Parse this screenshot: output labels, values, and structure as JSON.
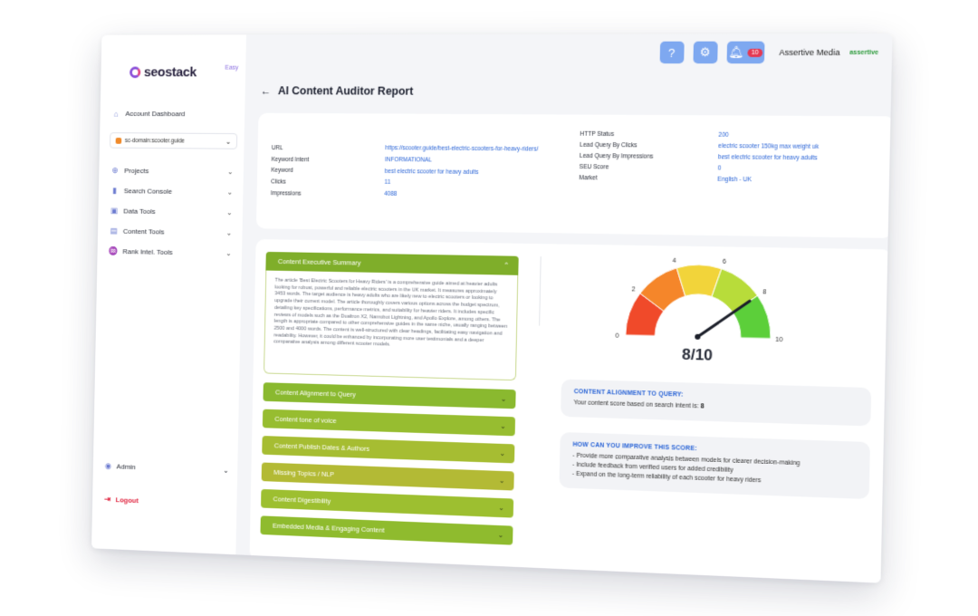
{
  "topbar": {
    "help_icon": "question-circle-icon",
    "settings_icon": "gear-icon",
    "notifications_count": "10",
    "company_name": "Assertive Media",
    "company_logo_text": "assertive"
  },
  "sidebar": {
    "logo_text": "seostack",
    "logo_side": "Easy",
    "account_dashboard": "Account Dashboard",
    "domain": "sc-domain:scooter.guide",
    "items": [
      {
        "label": "Projects",
        "icon": "globe-icon"
      },
      {
        "label": "Search Console",
        "icon": "bar-chart-icon"
      },
      {
        "label": "Data Tools",
        "icon": "data-icon"
      },
      {
        "label": "Content Tools",
        "icon": "content-icon"
      },
      {
        "label": "Rank Intel. Tools",
        "icon": "sitemap-icon"
      }
    ],
    "admin": "Admin",
    "logout": "Logout"
  },
  "page": {
    "title": "AI Content Auditor Report"
  },
  "info": {
    "left": [
      {
        "label": "URL",
        "value": "https://scooter.guide/best-electric-scooters-for-heavy-riders/"
      },
      {
        "label": "Keyword Intent",
        "value": "INFORMATIONAL"
      },
      {
        "label": "Keyword",
        "value": "best electric scooter for heavy adults"
      },
      {
        "label": "Clicks",
        "value": "11"
      },
      {
        "label": "Impressions",
        "value": "4088"
      }
    ],
    "right": [
      {
        "label": "HTTP Status",
        "value": "200"
      },
      {
        "label": "Lead Query By Clicks",
        "value": "electric scooter 150kg max weight uk"
      },
      {
        "label": "Lead Query By Impressions",
        "value": "best electric scooter for heavy adults"
      },
      {
        "label": "SEU Score",
        "value": "0"
      },
      {
        "label": "Market",
        "value": "English - UK"
      }
    ]
  },
  "accordion": {
    "open_title": "Content Executive Summary",
    "open_body": "The article 'Best Electric Scooters for Heavy Riders' is a comprehensive guide aimed at heavier adults looking for robust, powerful and reliable electric scooters in the UK market. It measures approximately 3453 words. The target audience is heavy adults who are likely new to electric scooters or looking to upgrade their current model. The article thoroughly covers various options across the budget spectrum, detailing key specifications, performance metrics, and suitability for heavier riders. It includes specific reviews of models such as the Dualtron X2, Nanrobot Lightning, and Apollo Explore, among others. The length is appropriate compared to other comprehensive guides in the same niche, usually ranging between 2500 and 4000 words. The content is well-structured with clear headings, facilitating easy navigation and readability. However, it could be enhanced by incorporating more user testimonials and a deeper comparative analysis among different scooter models.",
    "items": [
      "Content Alignment to Query",
      "Content tone of voice",
      "Content Publish Dates & Authors",
      "Missing Topics / NLP",
      "Content Digestibility",
      "Embedded Media & Engaging Content"
    ]
  },
  "gauge": {
    "ticks": [
      "0",
      "2",
      "4",
      "6",
      "8",
      "10"
    ],
    "score": 8,
    "max": 10,
    "score_label": "8/10",
    "colors": [
      "#f04a2a",
      "#f5862a",
      "#f2d43a",
      "#b8dc3a",
      "#5ccf3a"
    ]
  },
  "alignment": {
    "title": "CONTENT ALIGNMENT TO QUERY:",
    "text": "Your content score based on search intent is:",
    "score": "8"
  },
  "improve": {
    "title": "HOW CAN YOU IMPROVE THIS SCORE:",
    "items": [
      "- Provide more comparative analysis between models for clearer decision-making",
      "- Include feedback from verified users for added credibility",
      "- Expand on the long-term reliability of each scooter for heavy riders"
    ]
  }
}
